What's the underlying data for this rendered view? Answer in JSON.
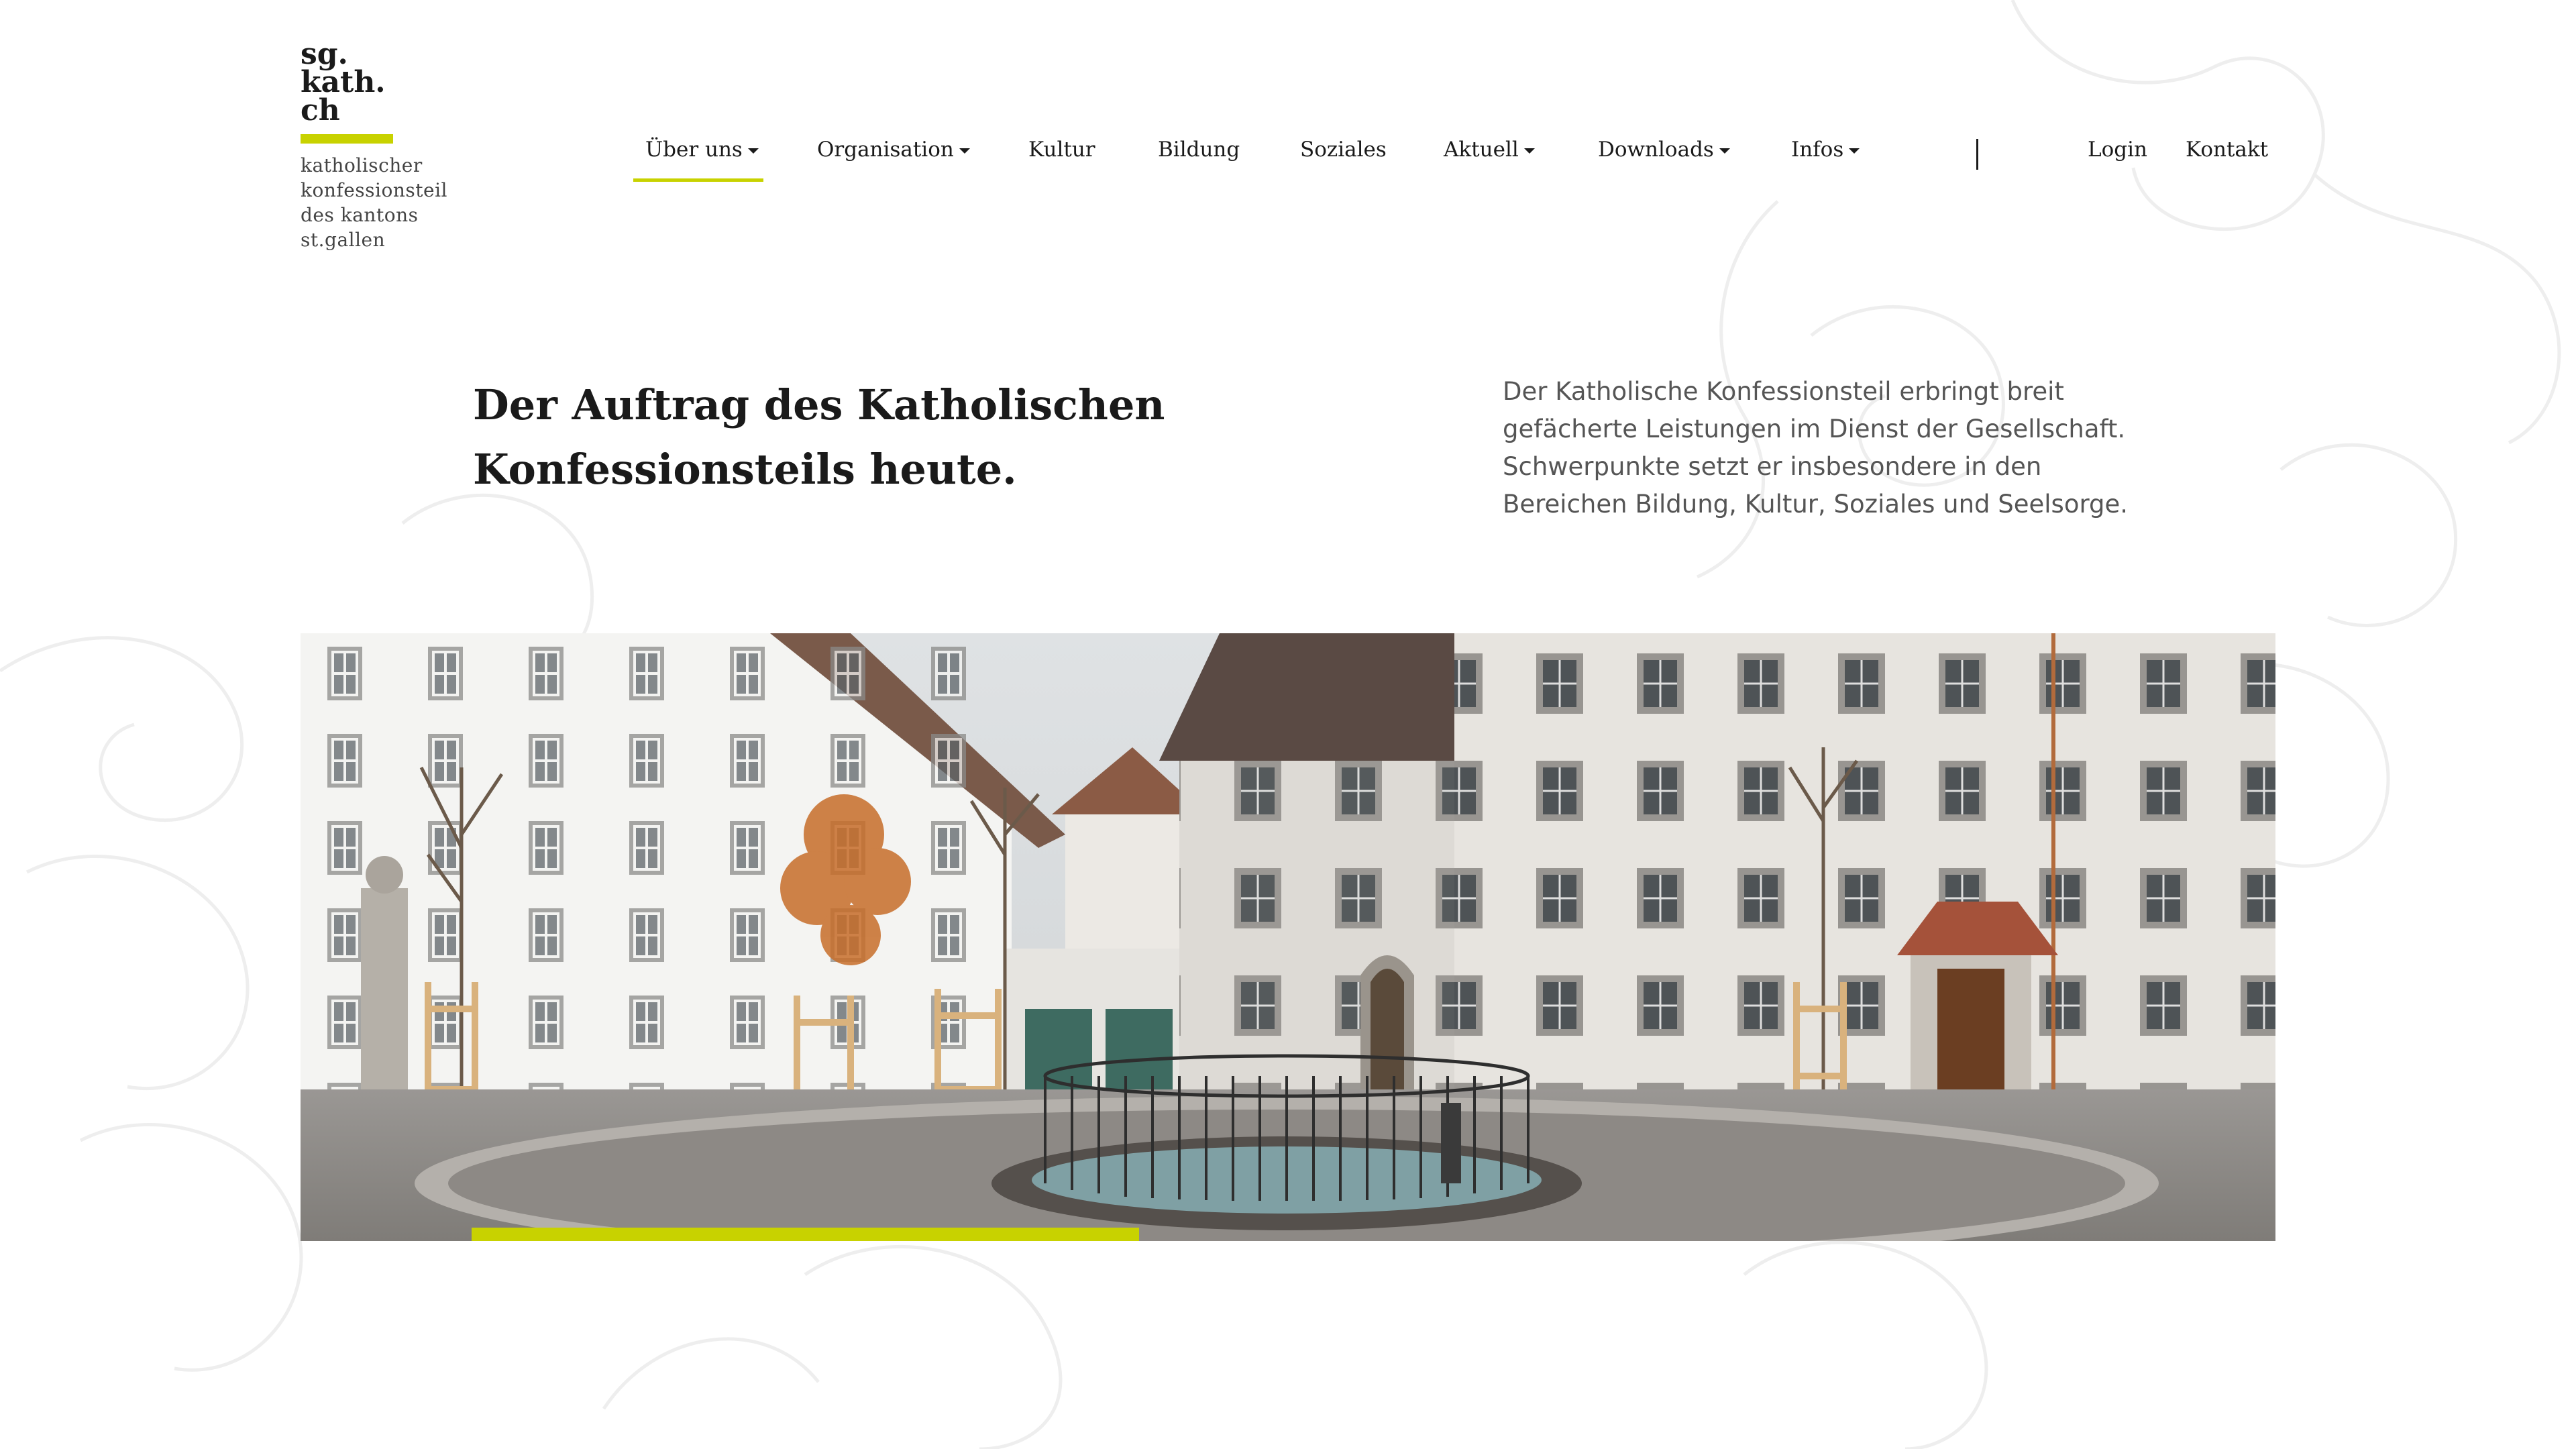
{
  "logo": {
    "mark_lines": [
      "sg.",
      "kath.",
      "ch"
    ],
    "subtitle_lines": [
      "katholischer",
      "konfessionsteil",
      "des kantons",
      "st.gallen"
    ]
  },
  "nav": {
    "items": [
      {
        "label": "Über uns",
        "has_dropdown": true,
        "active": true
      },
      {
        "label": "Organisation",
        "has_dropdown": true,
        "active": false
      },
      {
        "label": "Kultur",
        "has_dropdown": false,
        "active": false
      },
      {
        "label": "Bildung",
        "has_dropdown": false,
        "active": false
      },
      {
        "label": "Soziales",
        "has_dropdown": false,
        "active": false
      },
      {
        "label": "Aktuell",
        "has_dropdown": true,
        "active": false
      },
      {
        "label": "Downloads",
        "has_dropdown": true,
        "active": false
      },
      {
        "label": "Infos",
        "has_dropdown": true,
        "active": false
      }
    ],
    "login_label": "Login",
    "contact_label": "Kontakt"
  },
  "hero": {
    "headline_lines": [
      "Der Auftrag des Katholischen",
      "Konfessionsteils heute."
    ],
    "intro_lines": [
      "Der Katholische Konfessionsteil erbringt breit",
      "gefächerte Leistungen im Dienst der Gesellschaft.",
      "Schwerpunkte setzt er insbesondere in den",
      "Bereichen Bildung, Kultur, Soziales und Seelsorge."
    ],
    "image_subject": "courtyard with round fountain, white historic buildings, young trees and statue"
  },
  "colors": {
    "accent": "#c8d200",
    "text": "#1a1a1a",
    "muted_text": "#555555",
    "background": "#ffffff"
  },
  "icons": {
    "dropdown": "caret-down-icon"
  }
}
